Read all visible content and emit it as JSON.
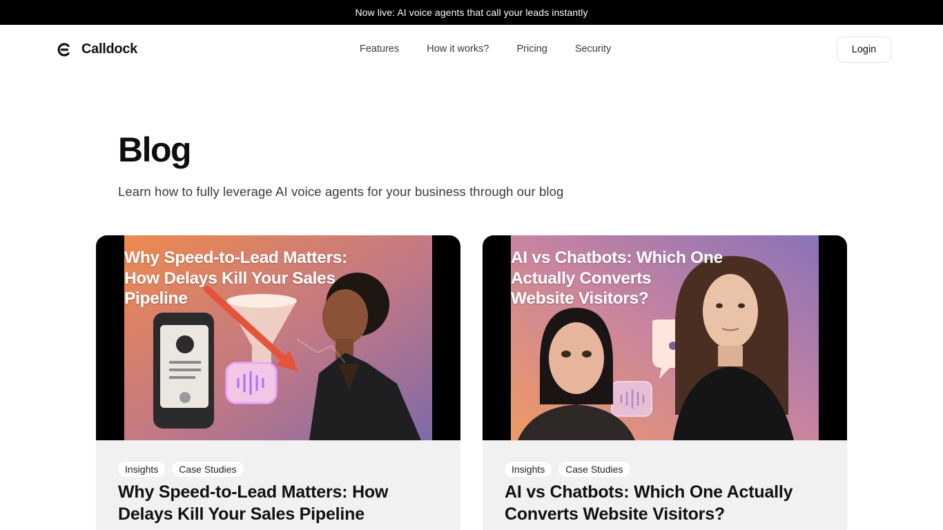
{
  "announcement": "Now live: AI voice agents that call your leads instantly",
  "brand": {
    "name": "Calldock",
    "logo_icon": "calldock-logo-icon"
  },
  "nav": {
    "items": [
      "Features",
      "How it works?",
      "Pricing",
      "Security"
    ],
    "login_label": "Login"
  },
  "page": {
    "title": "Blog",
    "subtitle": "Learn how to fully leverage AI voice agents for your business through our blog"
  },
  "posts": [
    {
      "image_lines": [
        "Why Speed-to-Lead Matters:",
        "How Delays Kill Your Sales",
        "Pipeline"
      ],
      "tags": [
        "Insights",
        "Case Studies"
      ],
      "title_lines": [
        "Why Speed-to-Lead Matters: How",
        "Delays Kill Your Sales Pipeline"
      ]
    },
    {
      "image_lines": [
        "AI vs Chatbots: Which One",
        "Actually Converts",
        "Website Visitors?"
      ],
      "tags": [
        "Insights",
        "Case Studies"
      ],
      "title_lines": [
        "AI vs Chatbots: Which One Actually",
        "Converts Website Visitors?"
      ]
    }
  ],
  "colors": {
    "announcement_bg": "#000000",
    "card_bg": "#f1f1f1",
    "thumb_gradient_start": "#e98a55",
    "thumb_gradient_end": "#8a6fb0"
  }
}
